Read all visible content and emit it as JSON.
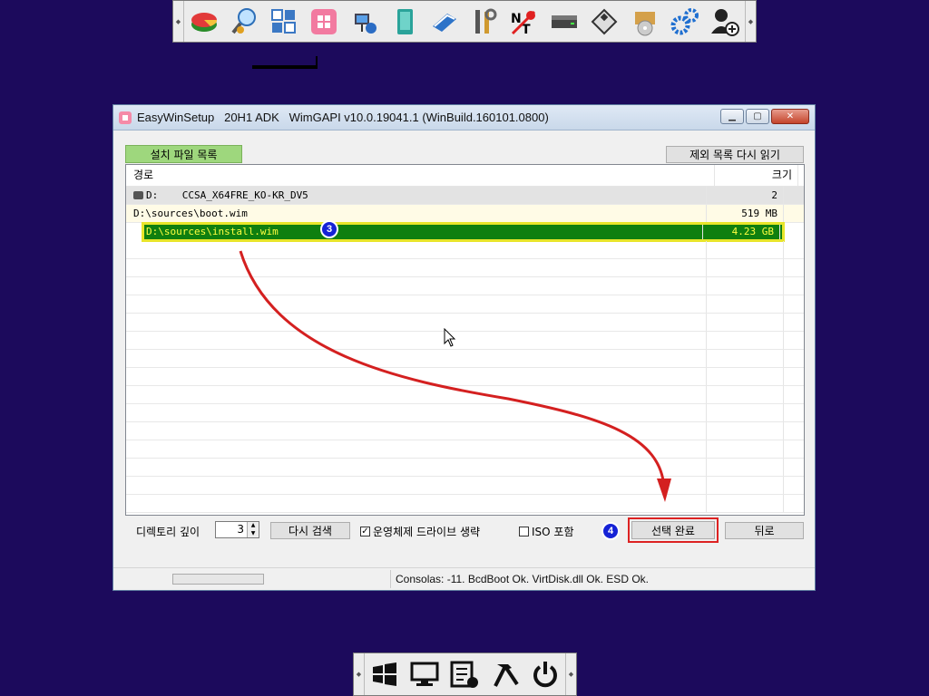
{
  "top_toolbar": {
    "icons": [
      "partition-manager-icon",
      "user-search-icon",
      "tiles-icon",
      "windows-app-icon",
      "network-computer-icon",
      "notebook-icon",
      "keyboard-pen-icon",
      "tools-icon",
      "ntpwedit-icon",
      "hard-drive-icon",
      "floppy-icon",
      "box-disc-icon",
      "gears-icon",
      "add-user-icon"
    ]
  },
  "window": {
    "title": "EasyWinSetup   20H1 ADK   WimGAPI v10.0.19041.1 (WinBuild.160101.0800)",
    "tab_label": "설치 파일 목록",
    "reread_button": "제외 목록 다시 읽기",
    "columns": {
      "path": "경로",
      "size": "크기"
    },
    "rows": [
      {
        "path": "D:    CCSA_X64FRE_KO-KR_DV5",
        "size": "2"
      },
      {
        "path": "D:\\sources\\boot.wim",
        "size": "519 MB"
      },
      {
        "path": "D:\\sources\\install.wim",
        "size": "4.23 GB"
      }
    ],
    "controls": {
      "depth_label": "디렉토리 깊이",
      "depth_value": "3",
      "rescan_button": "다시 검색",
      "skip_os_drive_label": "운영체제 드라이브 생략",
      "skip_os_drive_checked": "✓",
      "iso_include_label": "ISO 포함",
      "done_button": "선택 완료",
      "back_button": "뒤로"
    },
    "status": {
      "text": "Consolas: -11. BcdBoot Ok. VirtDisk.dll Ok. ESD Ok."
    }
  },
  "markers": {
    "step3": "3",
    "step4": "4"
  },
  "bottom_toolbar": {
    "icons": [
      "windows-flag-icon",
      "monitor-icon",
      "task-list-icon",
      "hammer-icon",
      "power-icon"
    ]
  },
  "colors": {
    "desktop": "#1c0a5c",
    "selected_row": "#0f7f0f",
    "selected_text": "#ffff40",
    "annotation_red": "#d42020",
    "marker_blue": "#1522d6"
  }
}
